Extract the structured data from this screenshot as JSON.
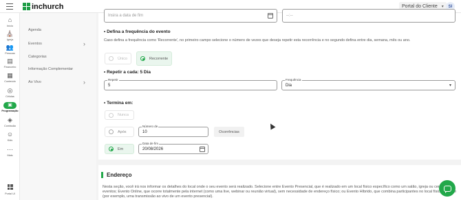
{
  "header": {
    "logo_text": "inchurch",
    "portal_label": "Portal do Cliente",
    "avatar_initials": "SI"
  },
  "rail": [
    {
      "label": "Início",
      "icon": "home-icon",
      "glyph": "⌂"
    },
    {
      "label": "Igreja",
      "icon": "church-icon",
      "glyph": "⛪"
    },
    {
      "label": "Pessoas",
      "icon": "people-icon",
      "glyph": "👥"
    },
    {
      "label": "Financeiro",
      "icon": "finance-icon",
      "glyph": "▤"
    },
    {
      "label": "Conteúdo",
      "icon": "content-icon",
      "glyph": "▦"
    },
    {
      "label": "Células",
      "icon": "cells-icon",
      "glyph": "◎"
    },
    {
      "label": "Programação",
      "icon": "calendar-icon",
      "glyph": "▣"
    },
    {
      "label": "Comissão",
      "icon": "commission-icon",
      "glyph": "◈"
    },
    {
      "label": "Kids",
      "icon": "kids-icon",
      "glyph": "☺"
    },
    {
      "label": "Mais",
      "icon": "more-icon",
      "glyph": "⋯"
    },
    {
      "label": "Portal UI",
      "icon": "apps-icon",
      "glyph": ""
    }
  ],
  "submenu": [
    {
      "label": "Agenda",
      "has_arrow": false
    },
    {
      "label": "Eventos",
      "has_arrow": true
    },
    {
      "label": "Categorias",
      "has_arrow": false
    },
    {
      "label": "Informação Complementar",
      "has_arrow": false
    },
    {
      "label": "Ao Vivo",
      "has_arrow": true
    }
  ],
  "form": {
    "end_date_placeholder": "Insira a data de fim",
    "end_time_placeholder": "--:--",
    "frequency_title": "Defina a frequência do evento",
    "frequency_desc": "Caso defina a frequência como 'Recorrente', no primeiro campo selecione o número de vezes que deseja repetir esta recorrência e no segundo defina entre dia, semana, mês ou ano.",
    "opt_unique": "Único",
    "opt_recurrent": "Recorrente",
    "repeat_title": "Repetir a cada: 5 Dia",
    "repeat_label": "Repetir",
    "repeat_value": "5",
    "frequency_label": "Frequência",
    "frequency_value": "Dia",
    "ends_title": "Termina em:",
    "opt_never": "Nunca",
    "opt_after": "Após",
    "count_label": "Número de",
    "count_value": "10",
    "occurrences_label": "Ocorrências",
    "opt_on": "Em",
    "enddate_label": "Data de fim",
    "enddate_value": "20/08/2026"
  },
  "address": {
    "title": "Endereço",
    "text": "Nesta seção, você irá nos informar os detalhes do local onde o seu evento será realizado. Selecione entre Evento Presencial, que é realizado em um local físico específico como um salão, igreja ou centro de eventos; Evento Online, que ocorre totalmente pela internet (como uma live, webinar ou reunião virtual), sem necessidade de endereço físico; ou Evento Híbrido, que combina participantes no local físico e online (por exemplo, uma transmissão ao vivo de um evento presencial)."
  },
  "colors": {
    "accent": "#22a84a"
  }
}
